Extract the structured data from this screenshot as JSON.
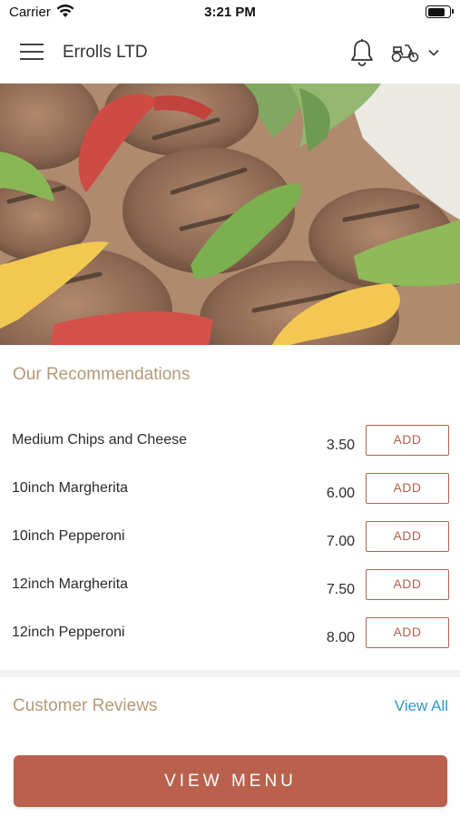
{
  "status_bar": {
    "carrier": "Carrier",
    "time": "3:21 PM",
    "battery_level": 0.85
  },
  "header": {
    "title": "Errolls LTD",
    "icons": [
      "menu-icon",
      "bell-icon",
      "scooter-icon",
      "chevron-down-icon"
    ]
  },
  "hero": {
    "image": "grilled meat and peppers"
  },
  "recommendations": {
    "title": "Our Recommendations",
    "items": [
      {
        "name": "Medium Chips and Cheese",
        "price": "3.50",
        "action": "ADD"
      },
      {
        "name": "10inch Margherita",
        "price": "6.00",
        "action": "ADD"
      },
      {
        "name": "10inch Pepperoni",
        "price": "7.00",
        "action": "ADD"
      },
      {
        "name": "12inch Margherita",
        "price": "7.50",
        "action": "ADD"
      },
      {
        "name": "12inch Pepperoni",
        "price": "8.00",
        "action": "ADD"
      }
    ]
  },
  "reviews": {
    "title": "Customer Reviews",
    "view_all": "View All"
  },
  "footer": {
    "button": "VIEW MENU"
  },
  "colors": {
    "accent": "#b9614d",
    "section_title": "#b49a78",
    "link": "#2e9ac8"
  }
}
